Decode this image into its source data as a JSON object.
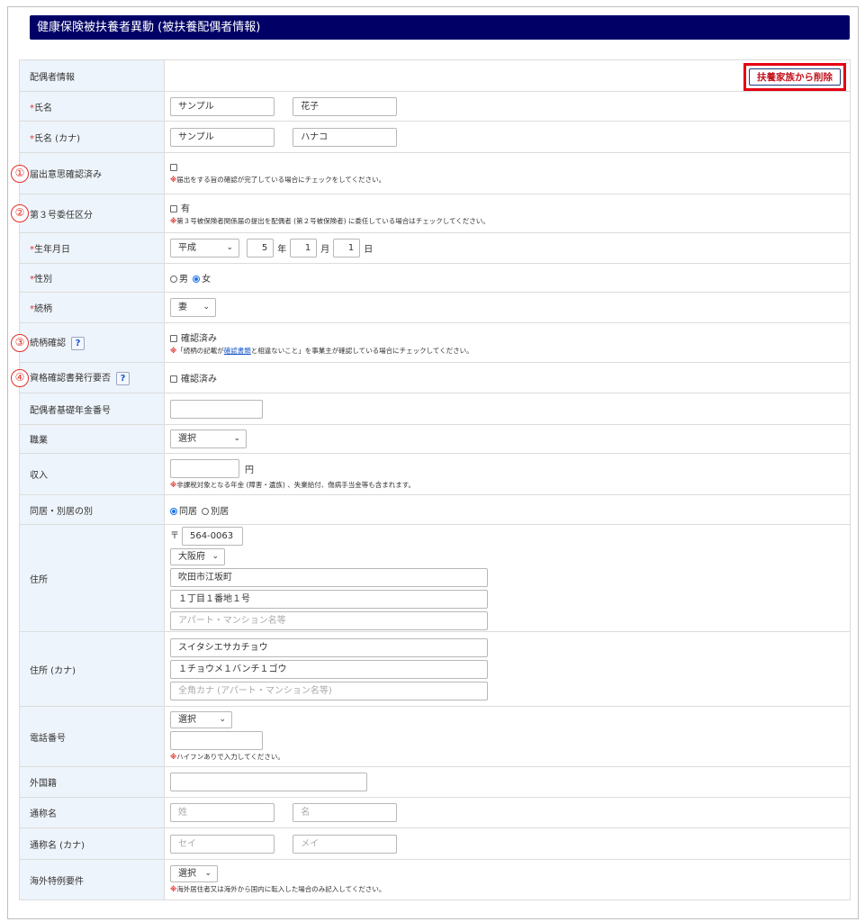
{
  "title": "健康保険被扶養者異動 (被扶養配偶者情報)",
  "delete_button": "扶養家族から削除",
  "required_mark": "*",
  "rows": {
    "spouse_info": {
      "label": "配偶者情報"
    },
    "name": {
      "label": "氏名",
      "last": "サンプル",
      "first": "花子"
    },
    "name_kana": {
      "label": "氏名 (カナ)",
      "last": "サンプル",
      "first": "ハナコ"
    },
    "intent": {
      "badge": "①",
      "label": "届出意思確認済み",
      "note": "届出をする旨の確認が完了している場合にチェックをしてください。"
    },
    "delegate": {
      "badge": "②",
      "label": "第３号委任区分",
      "option": "有",
      "note": "第３号被保険者関係届の提出を配偶者 (第２号被保険者) に委任している場合はチェックしてください。"
    },
    "birth": {
      "label": "生年月日",
      "era": "平成",
      "year": "5",
      "year_unit": "年",
      "month": "1",
      "month_unit": "月",
      "day": "1",
      "day_unit": "日"
    },
    "gender": {
      "label": "性別",
      "male": "男",
      "female": "女",
      "selected": "女"
    },
    "relation": {
      "label": "続柄",
      "value": "妻"
    },
    "relation_check": {
      "badge": "③",
      "label": "続柄確認",
      "help": "?",
      "option": "確認済み",
      "note_before": "「続柄の記載が",
      "note_link": "確認書類",
      "note_after": "と相違ないこと」を事業主が確認している場合にチェックしてください。"
    },
    "qualification": {
      "badge": "④",
      "label": "資格確認書発行要否",
      "help": "?",
      "option": "確認済み"
    },
    "pension_no": {
      "label": "配偶者基礎年金番号",
      "value": ""
    },
    "job": {
      "label": "職業",
      "value": "選択"
    },
    "income": {
      "label": "収入",
      "value": "",
      "unit": "円",
      "note": "非課税対象となる年金 (障害・遺族) 、失業給付、傷病手当金等も含まれます。"
    },
    "living": {
      "label": "同居・別居の別",
      "together": "同居",
      "apart": "別居",
      "selected": "同居"
    },
    "address": {
      "label": "住所",
      "postal_mark": "〒",
      "postal": "564-0063",
      "pref": "大阪府",
      "city": "吹田市江坂町",
      "street": "１丁目１番地１号",
      "building_placeholder": "アパート・マンション名等"
    },
    "address_kana": {
      "label": "住所 (カナ)",
      "line1": "スイタシエサカチョウ",
      "line2": "１チョウメ１バンチ１ゴウ",
      "line3_placeholder": "全角カナ (アパート・マンション名等)"
    },
    "phone": {
      "label": "電話番号",
      "type": "選択",
      "value": "",
      "note": "ハイフンありで入力してください。"
    },
    "nationality": {
      "label": "外国籍",
      "value": ""
    },
    "alias": {
      "label": "通称名",
      "last_placeholder": "姓",
      "first_placeholder": "名"
    },
    "alias_kana": {
      "label": "通称名 (カナ)",
      "last_placeholder": "セイ",
      "first_placeholder": "メイ"
    },
    "overseas": {
      "label": "海外特例要件",
      "value": "選択",
      "note": "海外居住者又は海外から国内に転入した場合のみ記入してください。"
    }
  },
  "note_mark": "※",
  "colors": {
    "header_bg": "#000066",
    "label_bg": "#eef4fb",
    "accent_red": "#e0302b",
    "link": "#1a57c8"
  }
}
